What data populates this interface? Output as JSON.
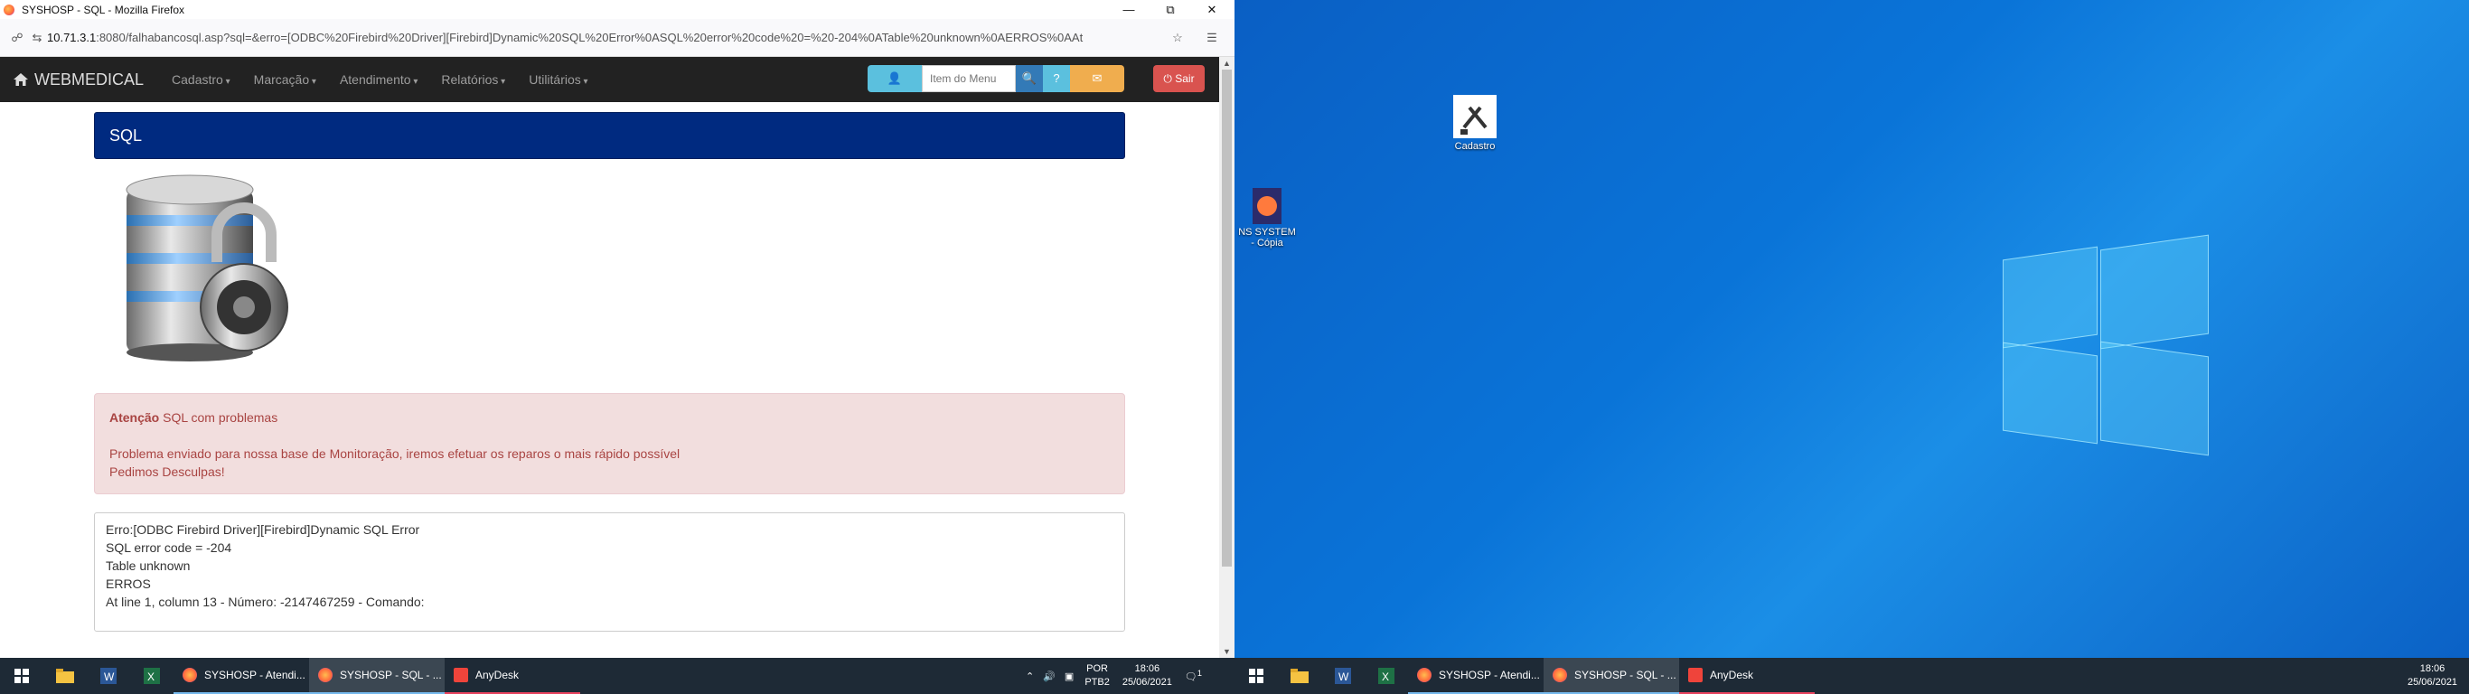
{
  "browser": {
    "window_title": "SYSHOSP - SQL - Mozilla Firefox",
    "url_host": "10.71.3.1",
    "url_rest": ":8080/falhabancosql.asp?sql=&erro=[ODBC%20Firebird%20Driver][Firebird]Dynamic%20SQL%20Error%0ASQL%20error%20code%20=%20-204%0ATable%20unknown%0AERROS%0AAt"
  },
  "navbar": {
    "brand": "WEBMEDICAL",
    "menu": [
      "Cadastro",
      "Marcação",
      "Atendimento",
      "Relatórios",
      "Utilitários"
    ],
    "search_placeholder": "Item do Menu",
    "exit_label": "Sair"
  },
  "content": {
    "panel_title": "SQL",
    "alert_title": "Atenção",
    "alert_subtitle": "SQL com problemas",
    "alert_line1": "Problema enviado para nossa base de Monitoração, iremos efetuar os reparos o mais rápido possível",
    "alert_line2": "Pedimos Desculpas!",
    "error_text": "Erro:[ODBC Firebird Driver][Firebird]Dynamic SQL Error\nSQL error code = -204\nTable unknown\nERROS\nAt line 1, column 13 - Número: -2147467259 - Comando:"
  },
  "taskbar_left": {
    "apps": [
      "SYSHOSP - Atendi...",
      "SYSHOSP - SQL - ...",
      "AnyDesk"
    ],
    "lang_top": "POR",
    "lang_bottom": "PTB2",
    "time": "18:06",
    "date": "25/06/2021",
    "notification_count": "1"
  },
  "taskbar_right": {
    "apps": [
      "SYSHOSP - Atendi...",
      "SYSHOSP - SQL - ...",
      "AnyDesk"
    ],
    "time": "18:06",
    "date": "25/06/2021"
  },
  "desktop": {
    "icon_cadastro": "Cadastro",
    "icon_ns_system": "NS SYSTEM - Cópia"
  }
}
